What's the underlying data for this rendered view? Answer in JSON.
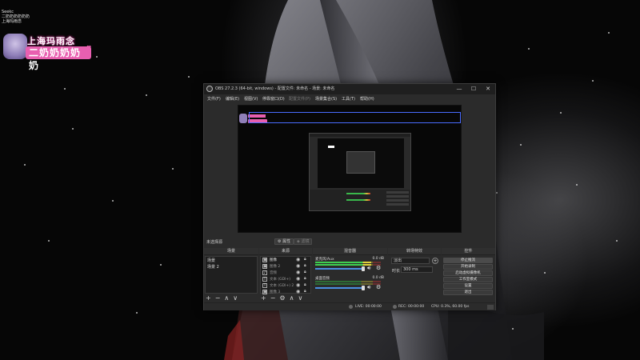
{
  "overlay": {
    "chat_lines": [
      "Seekc",
      "二奶奶奶奶奶奶",
      "上海玛雨念"
    ],
    "badge_line1": "上海玛雨念",
    "badge_line2": "二奶奶奶奶奶"
  },
  "window": {
    "title": "OBS 27.2.3 (64-bit, windows) - 配置文件: 未命名 - 场景: 未命名",
    "menu": [
      "文件(F)",
      "编辑(E)",
      "视图(V)",
      "停靠窗口(D)",
      "配置文件(P)",
      "场景集合(S)",
      "工具(T)",
      "帮助(H)"
    ]
  },
  "toolbar": {
    "no_source": "未选择源",
    "properties": "属性",
    "filters": "滤镜"
  },
  "scenes": {
    "header": "场景",
    "items": [
      "场景",
      "场景 2"
    ]
  },
  "sources": {
    "header": "来源",
    "items": [
      {
        "icon": "▣",
        "name": "图像"
      },
      {
        "icon": "▣",
        "name": "图像 2"
      },
      {
        "icon": "♪",
        "name": "音频"
      },
      {
        "icon": "T",
        "name": "文本 (GDI+)"
      },
      {
        "icon": "T",
        "name": "文本 (GDI+) 2"
      },
      {
        "icon": "▣",
        "name": "图像 3"
      }
    ]
  },
  "mixer": {
    "header": "混音器",
    "channels": [
      {
        "name": "麦克风/Aux",
        "db": "0.0 dB",
        "level": 0.85,
        "volume": 1.0
      },
      {
        "name": "桌面音频",
        "db": "0.0 dB",
        "level": 0.0,
        "volume": 1.0
      }
    ]
  },
  "transitions": {
    "header": "转场特效",
    "selected": "淡出",
    "duration_label": "时长",
    "duration": "300 ms"
  },
  "controls": {
    "header": "控件",
    "buttons": [
      "停止推流",
      "开始录制",
      "启动虚拟摄像机",
      "工作室模式",
      "设置",
      "退出"
    ]
  },
  "status": {
    "live": "LIVE: 00:00:00",
    "rec": "REC: 00:00:00",
    "cpu": "CPU: 0.3%, 60.00 fps"
  }
}
